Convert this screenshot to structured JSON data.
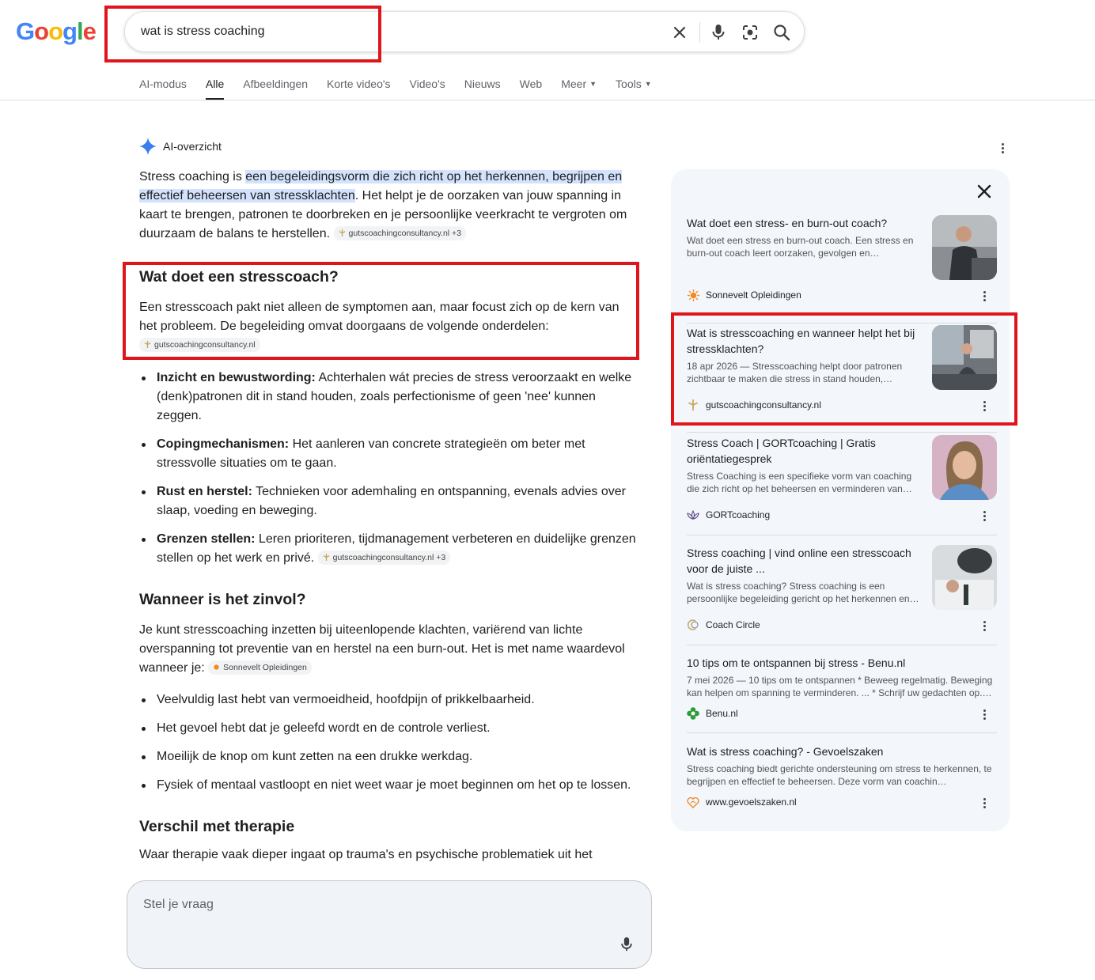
{
  "logo": {
    "letters": [
      "G",
      "o",
      "o",
      "g",
      "l",
      "e"
    ],
    "colors": [
      "#4285F4",
      "#EA4335",
      "#FBBC05",
      "#4285F4",
      "#34A853",
      "#EA4335"
    ]
  },
  "search": {
    "query": "wat is stress coaching"
  },
  "tabs": [
    {
      "label": "AI-modus"
    },
    {
      "label": "Alle"
    },
    {
      "label": "Afbeeldingen"
    },
    {
      "label": "Korte video's"
    },
    {
      "label": "Video's"
    },
    {
      "label": "Nieuws"
    },
    {
      "label": "Web"
    },
    {
      "label": "Meer"
    },
    {
      "label": "Tools"
    }
  ],
  "ai": {
    "label": "AI-overzicht",
    "intro_a": "Stress coaching is ",
    "intro_hl": "een begeleidingsvorm die zich richt op het herkennen, begrijpen en effectief beheersen van stressklachten",
    "intro_b": ". Het helpt je de oorzaken van jouw spanning in kaart te brengen, patronen te doorbreken en je persoonlijke veerkracht te vergroten om duurzaam de balans te herstellen.",
    "chip1": "gutscoachingconsultancy.nl +3",
    "h_doet": "Wat doet een stresscoach?",
    "doet_text": "Een stresscoach pakt niet alleen de symptomen aan, maar focust zich op de kern van het probleem. De begeleiding omvat doorgaans de volgende onderdelen:",
    "chip2": "gutscoachingconsultancy.nl",
    "bullets1": [
      {
        "bold": "Inzicht en bewustwording:",
        "text": " Achterhalen wát precies de stress veroorzaakt en welke (denk)patronen dit in stand houden, zoals perfectionisme of geen 'nee' kunnen zeggen."
      },
      {
        "bold": "Copingmechanismen:",
        "text": " Het aanleren van concrete strategieën om beter met stressvolle situaties om te gaan."
      },
      {
        "bold": "Rust en herstel:",
        "text": " Technieken voor ademhaling en ontspanning, evenals advies over slaap, voeding en beweging."
      },
      {
        "bold": "Grenzen stellen:",
        "text": " Leren prioriteren, tijdmanagement verbeteren en duidelijke grenzen stellen op het werk en privé."
      }
    ],
    "chip3": "gutscoachingconsultancy.nl +3",
    "h_wanneer": "Wanneer is het zinvol?",
    "wanneer_text": "Je kunt stresscoaching inzetten bij uiteenlopende klachten, variërend van lichte overspanning tot preventie van en herstel na een burn-out. Het is met name waardevol wanneer je:",
    "chip4": "Sonnevelt Opleidingen",
    "bullets2": [
      "Veelvuldig last hebt van vermoeidheid, hoofdpijn of prikkelbaarheid.",
      "Het gevoel hebt dat je geleefd wordt en de controle verliest.",
      "Moeilijk de knop om kunt zetten na een drukke werkdag.",
      "Fysiek of mentaal vastloopt en niet weet waar je moet beginnen om het op te lossen."
    ],
    "h_therapie": "Verschil met therapie",
    "therapie_text": "Waar therapie vaak dieper ingaat op trauma's en psychische problematiek uit het"
  },
  "ask": {
    "placeholder": "Stel je vraag"
  },
  "sources": [
    {
      "title": "Wat doet een stress- en burn-out coach?",
      "snippet": "Wat doet een stress en burn-out coach. Een stress en burn-out coach leert oorzaken, gevolgen en…",
      "site": "Sonnevelt Opleidingen",
      "fav": "sun-icon"
    },
    {
      "title": "Wat is stresscoaching en wanneer helpt het bij stressklachten?",
      "snippet": "18 apr 2026 — Stresscoaching helpt door patronen zichtbaar te maken die stress in stand houden,…",
      "site": "gutscoachingconsultancy.nl",
      "fav": "guts-icon"
    },
    {
      "title": "Stress Coach | GORTcoaching | Gratis oriëntatiegesprek",
      "snippet": "Stress Coaching is een specifieke vorm van coaching die zich richt op het beheersen en verminderen van…",
      "site": "GORTcoaching",
      "fav": "lotus-icon"
    },
    {
      "title": "Stress coaching | vind online een stresscoach voor de juiste ...",
      "snippet": "Wat is stress coaching? Stress coaching is een persoonlijke begeleiding gericht op het herkennen en…",
      "site": "Coach Circle",
      "fav": "circle-icon"
    },
    {
      "title": "10 tips om te ontspannen bij stress - Benu.nl",
      "snippet": "7 mei 2026 — 10 tips om te ontspannen * Beweeg regelmatig. Beweging kan helpen om spanning te verminderen. ... * Schrijf uw gedachten op.…",
      "site": "Benu.nl",
      "fav": "cross-icon"
    },
    {
      "title": "Wat is stress coaching? - Gevoelszaken",
      "snippet": "Stress coaching biedt gerichte ondersteuning om stress te herkennen, te begrijpen en effectief te beheersen. Deze vorm van coachin…",
      "site": "www.gevoelszaken.nl",
      "fav": "heart-icon"
    }
  ]
}
